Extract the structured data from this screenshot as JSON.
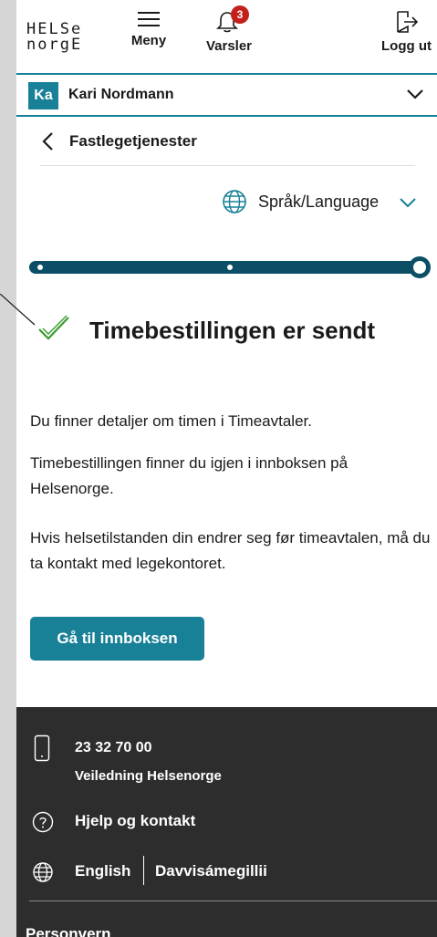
{
  "header": {
    "logo_top": "HELSe",
    "logo_bottom": "norgE",
    "menu_label": "Meny",
    "alerts_label": "Varsler",
    "alerts_count": "3",
    "logout_label": "Logg ut"
  },
  "user": {
    "initials": "Ka",
    "name": "Kari Nordmann"
  },
  "nav": {
    "back_label": "Fastlegetjenester"
  },
  "language": {
    "label": "Språk/Language"
  },
  "progress": {
    "steps": 3,
    "current_step": 3
  },
  "main": {
    "title": "Timebestillingen er sendt",
    "paragraphs": [
      "Du finner detaljer om timen i Timeavtaler.",
      "Timebestillingen finner du igjen i innboksen på Helsenorge.",
      "Hvis helsetilstanden din endrer seg før timeavtalen, må du ta kontakt med legekontoret."
    ],
    "cta_label": "Gå til innboksen"
  },
  "footer": {
    "phone": "23 32 70 00",
    "phone_caption": "Veiledning Helsenorge",
    "help_label": "Hjelp og kontakt",
    "lang_english": "English",
    "lang_sami": "Davvisámegillii",
    "privacy_label": "Personvern"
  },
  "colors": {
    "accent": "#188097",
    "progress": "#0b4e65",
    "success": "#3a9c2f",
    "badge": "#c3201b",
    "footer_bg": "#2d2d2d"
  }
}
